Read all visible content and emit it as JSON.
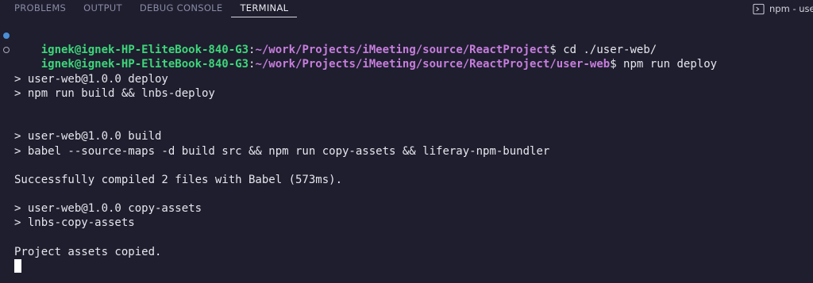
{
  "panel": {
    "tabs": [
      {
        "label": "PROBLEMS",
        "active": false
      },
      {
        "label": "OUTPUT",
        "active": false
      },
      {
        "label": "DEBUG CONSOLE",
        "active": false
      },
      {
        "label": "TERMINAL",
        "active": true
      }
    ],
    "terminal_instance_label": "npm - use"
  },
  "terminal": {
    "prompt1": {
      "user_host": "ignek@ignek-HP-EliteBook-840-G3",
      "sep": ":",
      "path": "~/work/Projects/iMeeting/source/ReactProject",
      "symbol": "$",
      "command": " cd ./user-web/"
    },
    "prompt2": {
      "user_host": "ignek@ignek-HP-EliteBook-840-G3",
      "sep": ":",
      "path": "~/work/Projects/iMeeting/source/ReactProject/user-web",
      "symbol": "$",
      "command": " npm run deploy"
    },
    "output": [
      "",
      "> user-web@1.0.0 deploy",
      "> npm run build && lnbs-deploy",
      "",
      "",
      "> user-web@1.0.0 build",
      "> babel --source-maps -d build src && npm run copy-assets && liferay-npm-bundler",
      "",
      "Successfully compiled 2 files with Babel (573ms).",
      "",
      "> user-web@1.0.0 copy-assets",
      "> lnbs-copy-assets",
      "",
      "Project assets copied."
    ]
  },
  "colors": {
    "background": "#1e1e2e",
    "user_host": "#3ed67a",
    "path": "#c77ddd",
    "text": "#e6e6ee"
  }
}
